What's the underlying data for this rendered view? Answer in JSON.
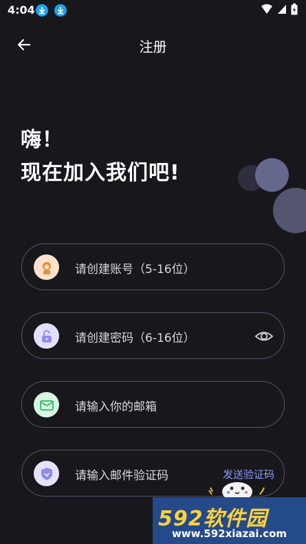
{
  "status_bar": {
    "time": "4:04"
  },
  "header": {
    "title": "注册"
  },
  "greeting": {
    "line1": "嗨！",
    "line2": "现在加入我们吧!"
  },
  "form": {
    "account_placeholder": "请创建账号（5-16位）",
    "password_placeholder": "请创建密码（6-16位）",
    "email_placeholder": "请输入你的邮箱",
    "code_placeholder": "请输入邮件验证码",
    "send_code_label": "发送验证码"
  },
  "watermark": {
    "brand": "592软件园",
    "url": "www.592xiazai.com"
  },
  "colors": {
    "background": "#17171c",
    "field_border": "#55566a",
    "accent": "#8e98f5",
    "account_icon_bg": "#ffe2cc",
    "password_icon_bg": "#e2e0fc",
    "email_icon_bg": "#d8f5e2",
    "code_icon_bg": "#e6e2fa"
  }
}
